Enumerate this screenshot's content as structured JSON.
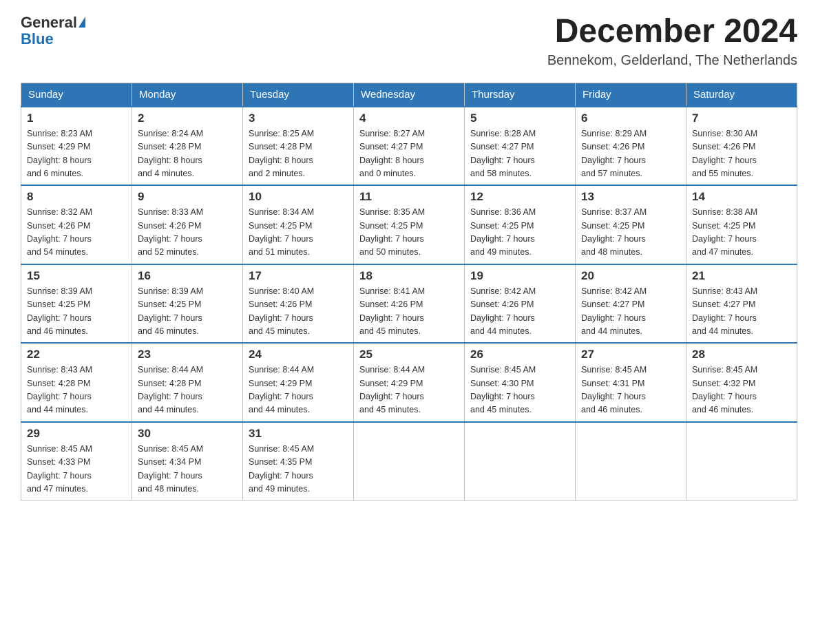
{
  "header": {
    "logo_general": "General",
    "logo_blue": "Blue",
    "month_year": "December 2024",
    "location": "Bennekom, Gelderland, The Netherlands"
  },
  "days_of_week": [
    "Sunday",
    "Monday",
    "Tuesday",
    "Wednesday",
    "Thursday",
    "Friday",
    "Saturday"
  ],
  "weeks": [
    [
      {
        "day": "1",
        "sunrise": "8:23 AM",
        "sunset": "4:29 PM",
        "daylight": "8 hours and 6 minutes."
      },
      {
        "day": "2",
        "sunrise": "8:24 AM",
        "sunset": "4:28 PM",
        "daylight": "8 hours and 4 minutes."
      },
      {
        "day": "3",
        "sunrise": "8:25 AM",
        "sunset": "4:28 PM",
        "daylight": "8 hours and 2 minutes."
      },
      {
        "day": "4",
        "sunrise": "8:27 AM",
        "sunset": "4:27 PM",
        "daylight": "8 hours and 0 minutes."
      },
      {
        "day": "5",
        "sunrise": "8:28 AM",
        "sunset": "4:27 PM",
        "daylight": "7 hours and 58 minutes."
      },
      {
        "day": "6",
        "sunrise": "8:29 AM",
        "sunset": "4:26 PM",
        "daylight": "7 hours and 57 minutes."
      },
      {
        "day": "7",
        "sunrise": "8:30 AM",
        "sunset": "4:26 PM",
        "daylight": "7 hours and 55 minutes."
      }
    ],
    [
      {
        "day": "8",
        "sunrise": "8:32 AM",
        "sunset": "4:26 PM",
        "daylight": "7 hours and 54 minutes."
      },
      {
        "day": "9",
        "sunrise": "8:33 AM",
        "sunset": "4:26 PM",
        "daylight": "7 hours and 52 minutes."
      },
      {
        "day": "10",
        "sunrise": "8:34 AM",
        "sunset": "4:25 PM",
        "daylight": "7 hours and 51 minutes."
      },
      {
        "day": "11",
        "sunrise": "8:35 AM",
        "sunset": "4:25 PM",
        "daylight": "7 hours and 50 minutes."
      },
      {
        "day": "12",
        "sunrise": "8:36 AM",
        "sunset": "4:25 PM",
        "daylight": "7 hours and 49 minutes."
      },
      {
        "day": "13",
        "sunrise": "8:37 AM",
        "sunset": "4:25 PM",
        "daylight": "7 hours and 48 minutes."
      },
      {
        "day": "14",
        "sunrise": "8:38 AM",
        "sunset": "4:25 PM",
        "daylight": "7 hours and 47 minutes."
      }
    ],
    [
      {
        "day": "15",
        "sunrise": "8:39 AM",
        "sunset": "4:25 PM",
        "daylight": "7 hours and 46 minutes."
      },
      {
        "day": "16",
        "sunrise": "8:39 AM",
        "sunset": "4:25 PM",
        "daylight": "7 hours and 46 minutes."
      },
      {
        "day": "17",
        "sunrise": "8:40 AM",
        "sunset": "4:26 PM",
        "daylight": "7 hours and 45 minutes."
      },
      {
        "day": "18",
        "sunrise": "8:41 AM",
        "sunset": "4:26 PM",
        "daylight": "7 hours and 45 minutes."
      },
      {
        "day": "19",
        "sunrise": "8:42 AM",
        "sunset": "4:26 PM",
        "daylight": "7 hours and 44 minutes."
      },
      {
        "day": "20",
        "sunrise": "8:42 AM",
        "sunset": "4:27 PM",
        "daylight": "7 hours and 44 minutes."
      },
      {
        "day": "21",
        "sunrise": "8:43 AM",
        "sunset": "4:27 PM",
        "daylight": "7 hours and 44 minutes."
      }
    ],
    [
      {
        "day": "22",
        "sunrise": "8:43 AM",
        "sunset": "4:28 PM",
        "daylight": "7 hours and 44 minutes."
      },
      {
        "day": "23",
        "sunrise": "8:44 AM",
        "sunset": "4:28 PM",
        "daylight": "7 hours and 44 minutes."
      },
      {
        "day": "24",
        "sunrise": "8:44 AM",
        "sunset": "4:29 PM",
        "daylight": "7 hours and 44 minutes."
      },
      {
        "day": "25",
        "sunrise": "8:44 AM",
        "sunset": "4:29 PM",
        "daylight": "7 hours and 45 minutes."
      },
      {
        "day": "26",
        "sunrise": "8:45 AM",
        "sunset": "4:30 PM",
        "daylight": "7 hours and 45 minutes."
      },
      {
        "day": "27",
        "sunrise": "8:45 AM",
        "sunset": "4:31 PM",
        "daylight": "7 hours and 46 minutes."
      },
      {
        "day": "28",
        "sunrise": "8:45 AM",
        "sunset": "4:32 PM",
        "daylight": "7 hours and 46 minutes."
      }
    ],
    [
      {
        "day": "29",
        "sunrise": "8:45 AM",
        "sunset": "4:33 PM",
        "daylight": "7 hours and 47 minutes."
      },
      {
        "day": "30",
        "sunrise": "8:45 AM",
        "sunset": "4:34 PM",
        "daylight": "7 hours and 48 minutes."
      },
      {
        "day": "31",
        "sunrise": "8:45 AM",
        "sunset": "4:35 PM",
        "daylight": "7 hours and 49 minutes."
      },
      null,
      null,
      null,
      null
    ]
  ],
  "labels": {
    "sunrise": "Sunrise:",
    "sunset": "Sunset:",
    "daylight": "Daylight:"
  }
}
